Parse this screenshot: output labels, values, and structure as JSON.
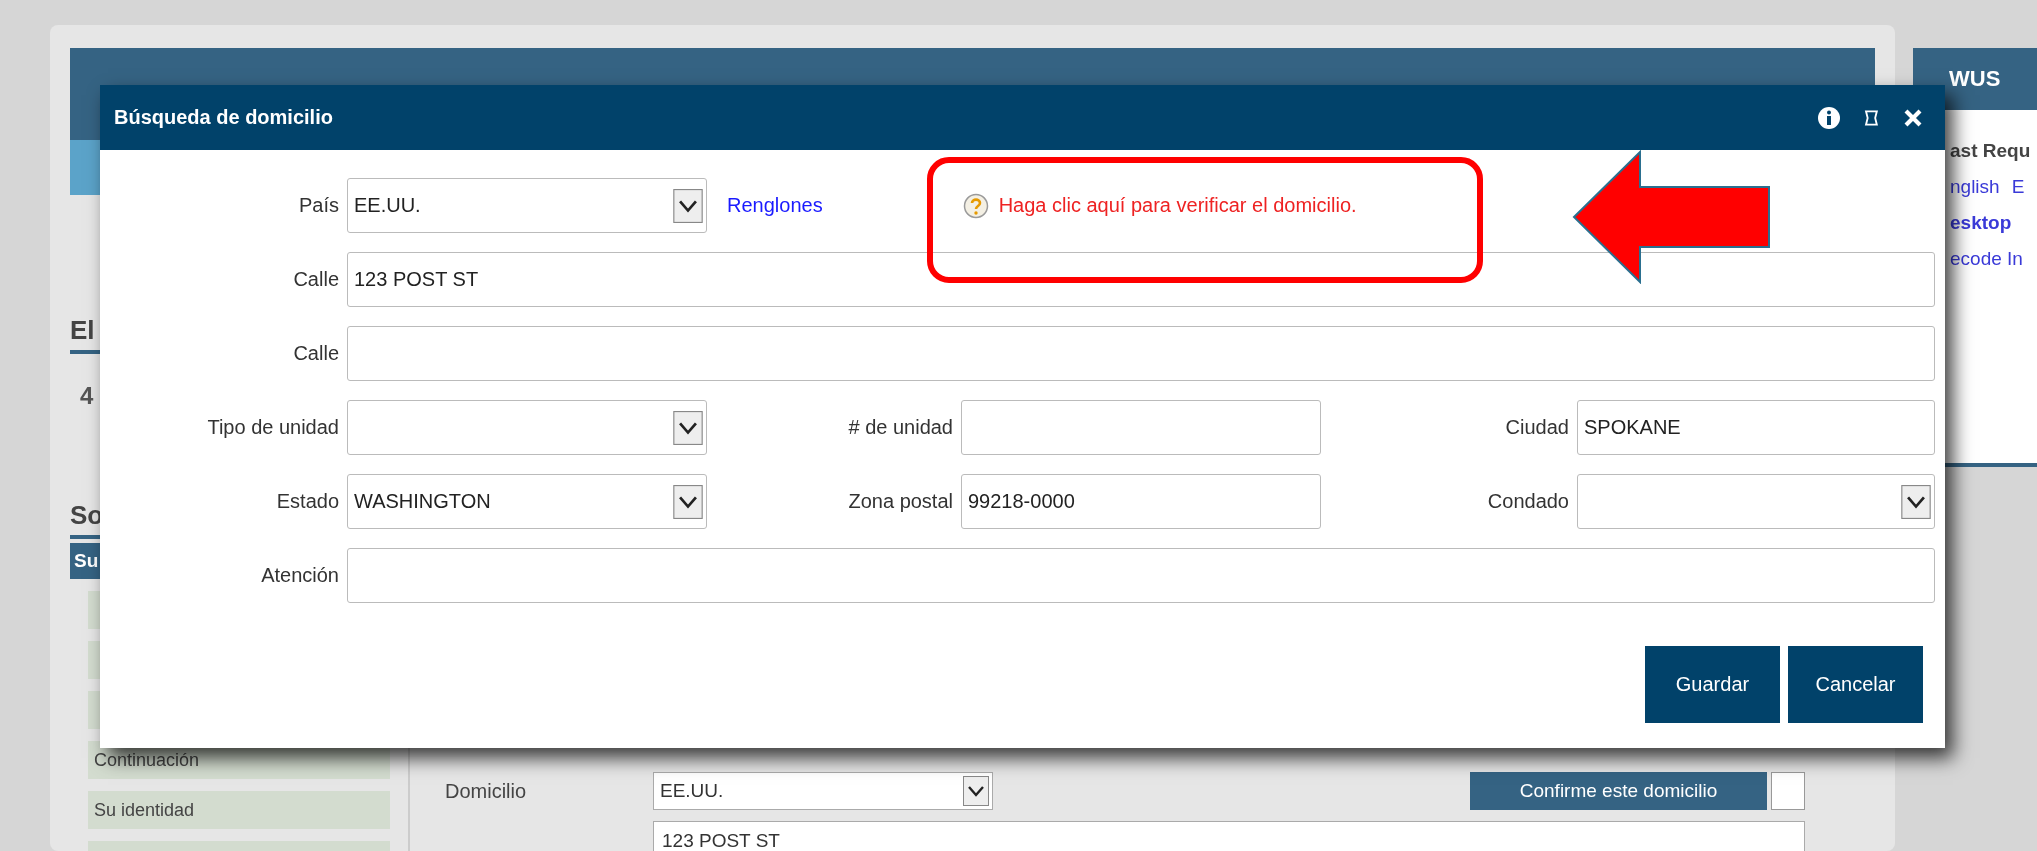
{
  "background": {
    "headings": [
      {
        "kind": "heading",
        "text": "El"
      },
      {
        "kind": "value",
        "text": "4"
      },
      {
        "kind": "heading",
        "text": "So"
      }
    ],
    "tab": {
      "label": "Su",
      "selected": true
    },
    "nav_items": [
      "Continuación",
      "Su identidad"
    ],
    "address": {
      "label": "Domicilio",
      "country": "EE.UU.",
      "street": "123 POST ST",
      "confirm_button": "Confirme este domicilio",
      "confirmed": false
    }
  },
  "side_panel": {
    "title": "WUS",
    "lines": [
      {
        "kind": "bold",
        "parts": [
          "ast Requ"
        ]
      },
      {
        "kind": "link",
        "parts": [
          "nglish",
          "E"
        ]
      },
      {
        "kind": "boldlink",
        "parts": [
          "esktop"
        ]
      },
      {
        "kind": "link",
        "parts": [
          "ecode In"
        ]
      }
    ]
  },
  "dialog": {
    "title": "Búsqueda de domicilio",
    "country": {
      "label": "País",
      "value": "EE.UU."
    },
    "lines_link": "Renglones",
    "verify_hint": "Haga clic aquí para verificar el domicilio.",
    "rows": [
      [
        {
          "label": "Calle",
          "kind": "text",
          "value": "123 POST ST"
        }
      ],
      [
        {
          "label": "Calle",
          "kind": "text"
        }
      ],
      [
        {
          "label": "Tipo de unidad",
          "kind": "select"
        },
        {
          "label": "# de unidad",
          "kind": "text"
        },
        {
          "label": "Ciudad",
          "kind": "text",
          "value": "SPOKANE"
        }
      ],
      [
        {
          "label": "Estado",
          "kind": "select",
          "value": "WASHINGTON"
        },
        {
          "label": "Zona postal",
          "kind": "text",
          "value": "99218-0000"
        },
        {
          "label": "Condado",
          "kind": "select"
        }
      ],
      [
        {
          "label": "Atención",
          "kind": "text"
        }
      ]
    ],
    "buttons": [
      "Guardar",
      "Cancelar"
    ]
  }
}
